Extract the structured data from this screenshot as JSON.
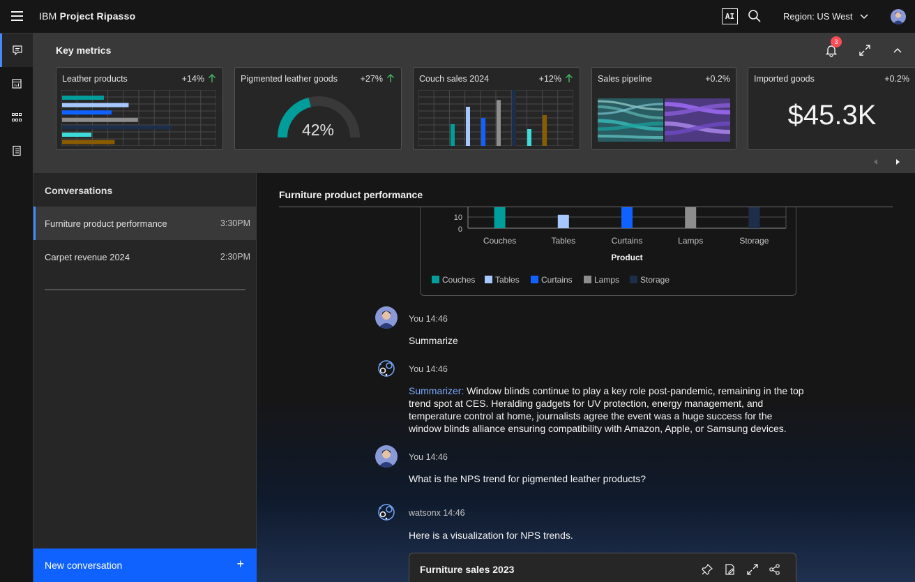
{
  "header": {
    "brand_prefix": "IBM",
    "brand_name": "Project Ripasso",
    "ai_badge": "AI",
    "region": "Region: US West"
  },
  "metrics": {
    "title": "Key metrics",
    "notification_count": "3",
    "cards": [
      {
        "title": "Leather products",
        "delta": "+14%",
        "trend": "up",
        "bars": [
          {
            "color": "#009d9a",
            "value": 0.27
          },
          {
            "color": "#a6c8ff",
            "value": 0.43
          },
          {
            "color": "#0f62fe",
            "value": 0.32
          },
          {
            "color": "#8d8d8d",
            "value": 0.49
          },
          {
            "color": "#1c2e4a",
            "value": 0.71
          },
          {
            "color": "#3ddbd9",
            "value": 0.19
          },
          {
            "color": "#8a5c00",
            "value": 0.34
          }
        ]
      },
      {
        "title": "Pigmented leather goods",
        "delta": "+27%",
        "trend": "up",
        "gauge_value": "42%",
        "gauge_fraction": 0.42
      },
      {
        "title": "Couch sales 2024",
        "delta": "+12%",
        "trend": "up",
        "bars": [
          {
            "color": "#009d9a",
            "value": 0.39
          },
          {
            "color": "#a6c8ff",
            "value": 0.7
          },
          {
            "color": "#0f62fe",
            "value": 0.5
          },
          {
            "color": "#8d8d8d",
            "value": 0.82
          },
          {
            "color": "#1c2e4a",
            "value": 1.0
          },
          {
            "color": "#3ddbd9",
            "value": 0.3
          },
          {
            "color": "#8a5c00",
            "value": 0.55
          }
        ]
      },
      {
        "title": "Sales pipeline",
        "delta": "+0.2%"
      },
      {
        "title": "Imported goods",
        "delta": "+0.2%",
        "big_value": "$45.3K"
      }
    ]
  },
  "conversations": {
    "title": "Conversations",
    "items": [
      {
        "label": "Furniture product performance",
        "time": "3:30PM",
        "active": true
      },
      {
        "label": "Carpet revenue 2024",
        "time": "2:30PM",
        "active": false
      }
    ],
    "new_button": "New conversation",
    "new_plus": "+"
  },
  "main": {
    "title": "Furniture product performance",
    "chart_data": {
      "type": "bar",
      "categories": [
        "Couches",
        "Tables",
        "Curtains",
        "Lamps",
        "Storage"
      ],
      "values": [
        20,
        12,
        20,
        20,
        20
      ],
      "colors": [
        "#009d9a",
        "#a6c8ff",
        "#0f62fe",
        "#8d8d8d",
        "#1c2e4a"
      ],
      "y_ticks": [
        "10",
        "0"
      ],
      "xlabel": "Product",
      "legend": [
        "Couches",
        "Tables",
        "Curtains",
        "Lamps",
        "Storage"
      ]
    },
    "messages": [
      {
        "author": "You 14:46",
        "kind": "user",
        "text": "Summarize"
      },
      {
        "author": "You 14:46",
        "kind": "bot",
        "label": "Summarizer:",
        "text": " Window blinds continue to play a key role post-pandemic, remaining in the top trend spot at CES. Heralding gadgets for UV protection, energy management, and temperature control at home, journalists agree the event was a huge success for the window blinds alliance ensuring compatibility with Amazon, Apple, or Samsung devices."
      },
      {
        "author": "You 14:46",
        "kind": "user",
        "text": "What is the NPS trend for pigmented leather products?"
      },
      {
        "author": "watsonx 14:46",
        "kind": "bot",
        "text": "Here is a visualization for NPS trends."
      }
    ],
    "sales_card_title": "Furniture sales 2023"
  }
}
